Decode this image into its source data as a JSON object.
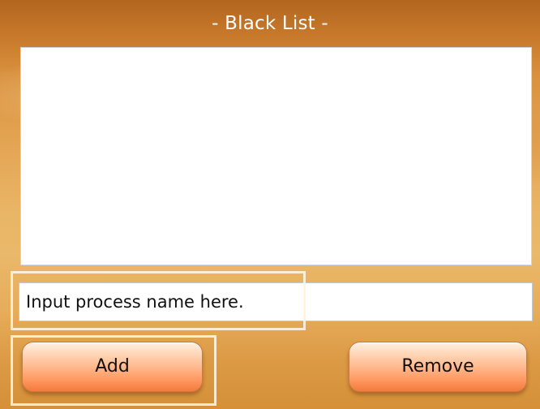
{
  "window": {
    "title": "- Black List -"
  },
  "blacklist": {
    "items": []
  },
  "input": {
    "placeholder": "Input process name here.",
    "value": ""
  },
  "buttons": {
    "add_label": "Add",
    "remove_label": "Remove"
  },
  "colors": {
    "background_top": "#b2661f",
    "background_mid": "#e9b566",
    "button_orange": "#ff9c66",
    "highlight": "#fff4e1"
  }
}
